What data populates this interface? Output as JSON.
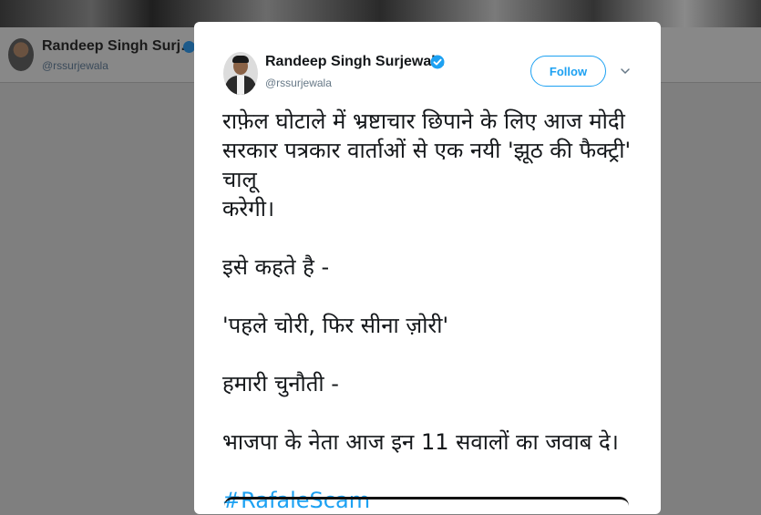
{
  "background": {
    "name": "Randeep Singh Surj…",
    "handle": "@rssurjewala"
  },
  "tweet": {
    "author_name": "Randeep Singh Surjewala",
    "author_handle": "@rssurjewala",
    "follow_label": "Follow",
    "lines": [
      "राफ़ेल घोटाले में भ्रष्टाचार छिपाने के लिए आज मोदी",
      "सरकार पत्रकार वार्ताओं से एक नयी 'झूठ की फैक्ट्री' चालू",
      "करेगी।"
    ],
    "para2": "इसे कहते है -",
    "para3": "'पहले चोरी, फिर सीना ज़ोरी'",
    "para4": "हमारी चुनौती -",
    "para5": "भाजपा के नेता आज इन 11 सवालों का जवाब दे।",
    "hashtag": "#RafaleScam"
  },
  "colors": {
    "accent": "#1da1f2",
    "text": "#14171a",
    "secondary": "#657786",
    "overlay": "#7f7f7f"
  },
  "icons": {
    "verified": "verified-badge-icon",
    "caret": "chevron-down-icon"
  }
}
